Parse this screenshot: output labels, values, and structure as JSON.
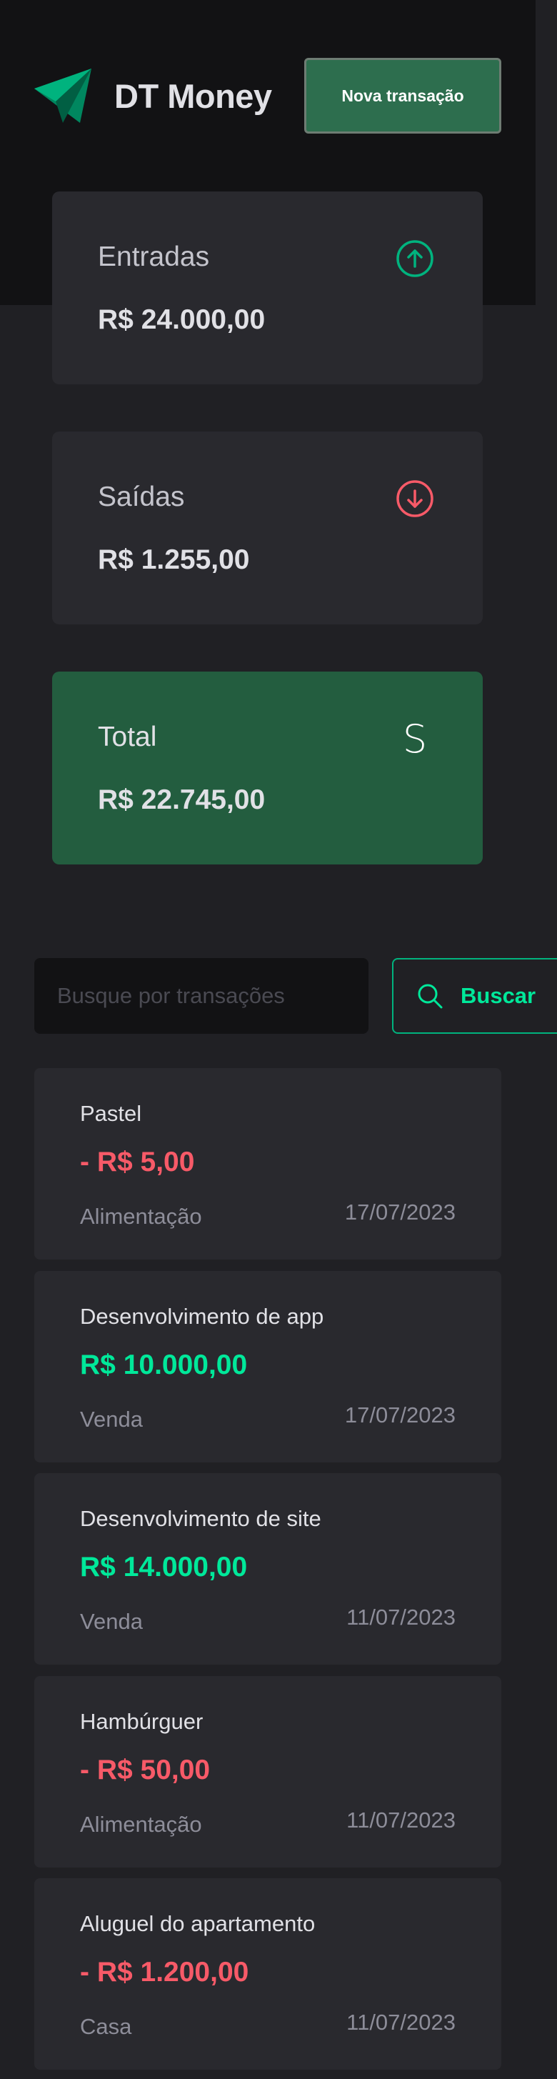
{
  "header": {
    "app_name": "DT Money",
    "logo_icon": "logo-icon",
    "new_transaction_label": "Nova transação"
  },
  "summary": [
    {
      "label": "Entradas",
      "value": "R$ 24.000,00",
      "icon": "arrow-circle-up-icon",
      "icon_color": "#00b37e"
    },
    {
      "label": "Saídas",
      "value": "R$ 1.255,00",
      "icon": "arrow-circle-down-icon",
      "icon_color": "#f75a68"
    },
    {
      "label": "Total",
      "value": "R$ 22.745,00",
      "icon": "dollar-icon",
      "icon_glyph": "S",
      "icon_color": "#ffffff"
    }
  ],
  "search": {
    "placeholder": "Busque por transações",
    "value": "",
    "button_label": "Buscar"
  },
  "transactions": [
    {
      "description": "Pastel",
      "value": "- R$ 5,00",
      "type": "outcome",
      "category": "Alimentação",
      "date": "17/07/2023"
    },
    {
      "description": "Desenvolvimento de app",
      "value": "R$ 10.000,00",
      "type": "income",
      "category": "Venda",
      "date": "17/07/2023"
    },
    {
      "description": "Desenvolvimento de site",
      "value": "R$ 14.000,00",
      "type": "income",
      "category": "Venda",
      "date": "11/07/2023"
    },
    {
      "description": "Hambúrguer",
      "value": "- R$ 50,00",
      "type": "outcome",
      "category": "Alimentação",
      "date": "11/07/2023"
    },
    {
      "description": "Aluguel do apartamento",
      "value": "- R$ 1.200,00",
      "type": "outcome",
      "category": "Casa",
      "date": "11/07/2023"
    }
  ],
  "colors": {
    "background": "#202024",
    "header_background": "#121214",
    "card_background": "#29292e",
    "total_card": "#235d3f",
    "brand_green": "#00b37e",
    "income": "#00e89a",
    "outcome": "#f75a68"
  }
}
